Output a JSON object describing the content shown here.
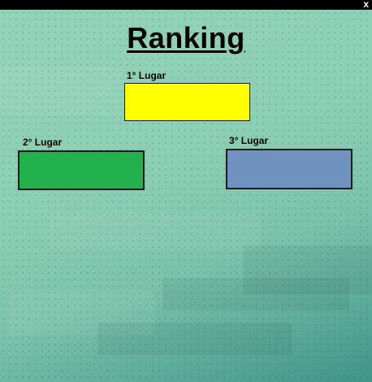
{
  "window": {
    "close_label": "x"
  },
  "title": "Ranking",
  "places": [
    {
      "label": "1° Lugar",
      "color": "#ffff00"
    },
    {
      "label": "2° Lugar",
      "color": "#22b14c"
    },
    {
      "label": "3° Lugar",
      "color": "#7092be"
    }
  ]
}
